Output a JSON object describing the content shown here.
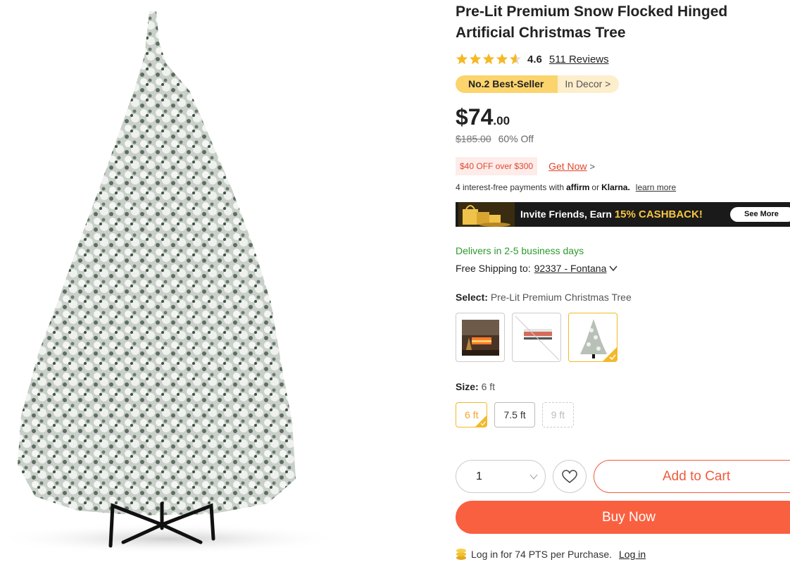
{
  "product": {
    "title": "Pre-Lit Premium Snow Flocked Hinged Artificial Christmas Tree",
    "rating": {
      "value": "4.6",
      "stars": 4.6,
      "reviews_label": "511 Reviews"
    },
    "badge": {
      "rank_label": "No.2 Best-Seller",
      "category_label": "In Decor >"
    },
    "price": {
      "main": "$74",
      "cents": ".00",
      "original": "$185.00",
      "discount": "60% Off"
    },
    "promo": {
      "tag": "$40 OFF over $300",
      "link": "Get Now",
      "arrow": ">"
    },
    "payments": {
      "text": "4 interest-free payments with",
      "affirm": "affirm",
      "or": "or",
      "klarna": "Klarna.",
      "learn_more": "learn more"
    },
    "banner": {
      "text_start": "Invite Friends, Earn ",
      "highlight": "15% CASHBACK!",
      "button": "See More"
    },
    "delivery": "Delivers in 2-5 business days",
    "shipping": {
      "label": "Free Shipping to:",
      "location": "92337 - Fontana"
    },
    "select": {
      "label": "Select:",
      "value": "Pre-Lit Premium Christmas Tree"
    },
    "variant_icons": [
      "fireplace-room-thumbnail",
      "electric-fireplace-thumbnail",
      "christmas-tree-thumbnail"
    ],
    "size": {
      "label": "Size:",
      "value": "6 ft",
      "options": [
        "6 ft",
        "7.5 ft",
        "9 ft"
      ]
    },
    "quantity": "1",
    "buttons": {
      "add_to_cart": "Add to Cart",
      "buy_now": "Buy Now"
    },
    "points": {
      "text": "Log in for 74 PTS per Purchase.",
      "link": "Log in"
    }
  },
  "colors": {
    "accent": "#f96040",
    "gold": "#fbd46d",
    "green": "#2e9a2e",
    "promo_red": "#e04a2f"
  }
}
